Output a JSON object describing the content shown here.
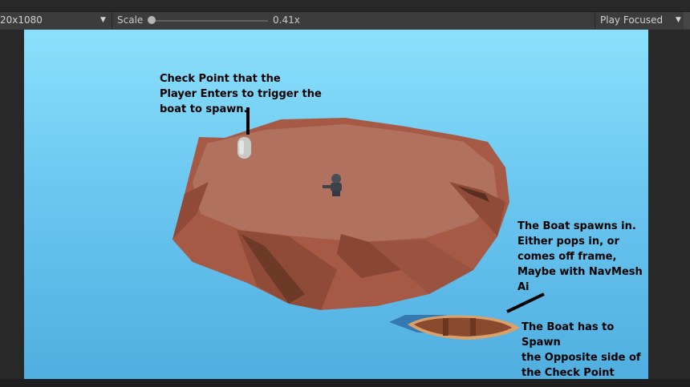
{
  "toolbar": {
    "resolution": "20x1080",
    "scale_label": "Scale",
    "scale_value": "0.41x",
    "play_mode": "Play Focused"
  },
  "scene": {
    "annotations": {
      "checkpoint_note": "Check Point that the\nPlayer Enters to trigger the\nboat to spawn.",
      "boat_spawn_note": "The Boat spawns in.\nEither pops in, or\ncomes off frame,\nMaybe with NavMesh\nAi",
      "opposite_side_note": "The Boat has to Spawn\nthe Opposite side of\nthe Check Point"
    }
  },
  "colors": {
    "sky_top": "#8be0fb",
    "sky_bottom": "#50aee0",
    "island": "#a65a45",
    "checkpoint": "#c9c9c9",
    "boat": "#8a4a2e"
  }
}
